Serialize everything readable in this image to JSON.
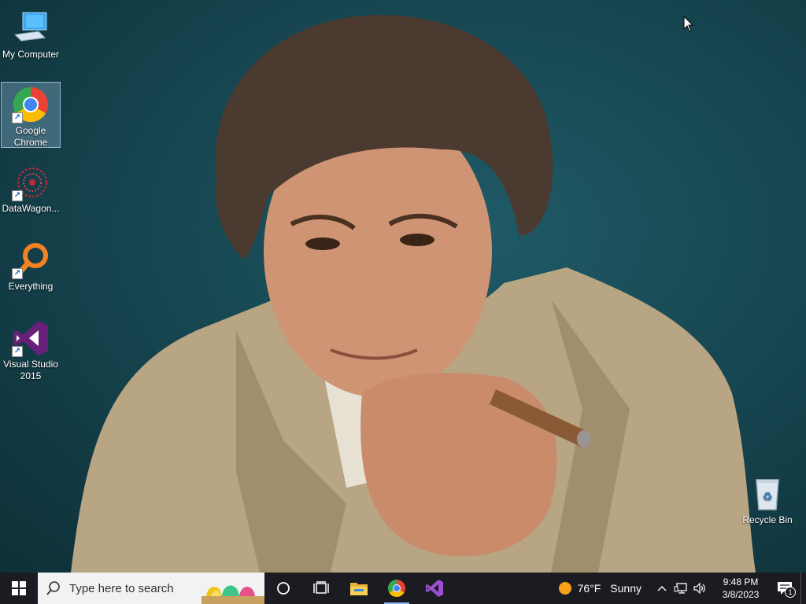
{
  "desktop": {
    "icons": [
      {
        "label": "My Computer",
        "icon": "computer-icon",
        "shortcut": false
      },
      {
        "label": "Google Chrome",
        "icon": "chrome-icon",
        "shortcut": true,
        "selected": true
      },
      {
        "label": "DataWagon...",
        "icon": "datawagon-icon",
        "shortcut": true
      },
      {
        "label": "Everything",
        "icon": "everything-search-icon",
        "shortcut": true
      },
      {
        "label": "Visual Studio 2015",
        "icon": "visual-studio-icon",
        "shortcut": true
      },
      {
        "label": "Recycle Bin",
        "icon": "recycle-bin-icon",
        "shortcut": false
      }
    ]
  },
  "taskbar": {
    "search_placeholder": "Type here to search",
    "pinned": [
      {
        "name": "file-explorer",
        "icon": "folder-icon"
      },
      {
        "name": "google-chrome",
        "icon": "chrome-icon"
      },
      {
        "name": "visual-studio",
        "icon": "visual-studio-icon"
      }
    ],
    "weather": {
      "temp": "76°F",
      "condition": "Sunny"
    },
    "clock": {
      "time": "9:48 PM",
      "date": "3/8/2023"
    },
    "notification_count": "1"
  },
  "colors": {
    "taskbar_bg": "#1b1b22",
    "desktop_bg": "#15434d",
    "chrome_red": "#ea4335",
    "chrome_yellow": "#fbbc05",
    "chrome_green": "#34a853",
    "chrome_blue": "#4285f4",
    "vs_purple": "#68217a",
    "everything_orange": "#f58220"
  }
}
